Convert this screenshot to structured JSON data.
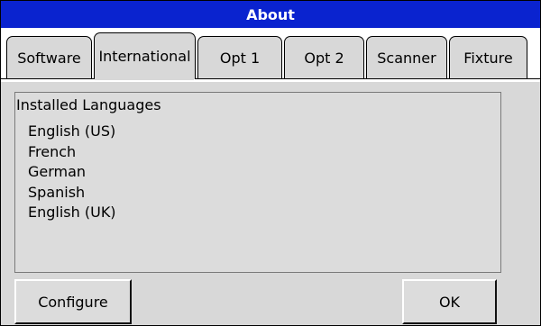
{
  "window": {
    "title": "About"
  },
  "tabs": [
    {
      "label": "Software",
      "active": false
    },
    {
      "label": "International",
      "active": true
    },
    {
      "label": "Opt 1",
      "active": false
    },
    {
      "label": "Opt 2",
      "active": false
    },
    {
      "label": "Scanner",
      "active": false
    },
    {
      "label": "Fixture",
      "active": false
    }
  ],
  "languages_panel": {
    "title": "Installed Languages",
    "items": [
      "English (US)",
      "French",
      "German",
      "Spanish",
      "English (UK)"
    ]
  },
  "buttons": {
    "configure": "Configure",
    "ok": "OK"
  },
  "colors": {
    "titlebar": "#0a23cf",
    "panel": "#d8d8d8"
  }
}
